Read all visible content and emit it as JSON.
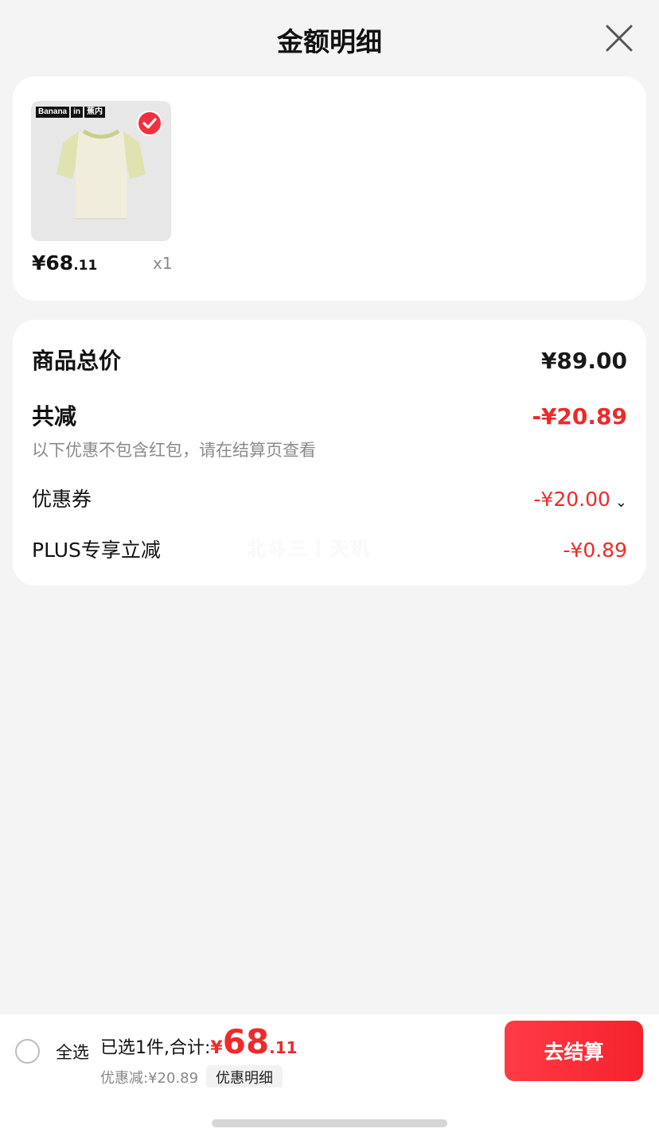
{
  "sheet": {
    "title": "金额明细",
    "close_icon": "close-icon"
  },
  "goods": {
    "brand_tags": [
      "Banana",
      "in",
      "蕉内"
    ],
    "checked": true,
    "price_int": "¥68",
    "price_dec": ".11",
    "quantity": "x1"
  },
  "detail": {
    "total_label": "商品总价",
    "total_value": "¥89.00",
    "reduce_label": "共减",
    "reduce_value": "-¥20.89",
    "note": "以下优惠不包含红包，请在结算页查看",
    "coupon_label": "优惠券",
    "coupon_value": "-¥20.00",
    "plus_label": "PLUS专享立减",
    "plus_value": "-¥0.89",
    "watermark": "北斗三丨天玑"
  },
  "bottom": {
    "select_all": "全选",
    "summary_prefix": "已选1件,合计:",
    "summary_yen": "¥",
    "summary_int": "68",
    "summary_dec": ".11",
    "discount_text": "优惠减:¥20.89",
    "detail_chip": "优惠明细",
    "checkout": "去结算"
  },
  "colors": {
    "accent_red": "#ee2a2a",
    "button_red": "#f5222d",
    "background": "#f4f4f4"
  }
}
